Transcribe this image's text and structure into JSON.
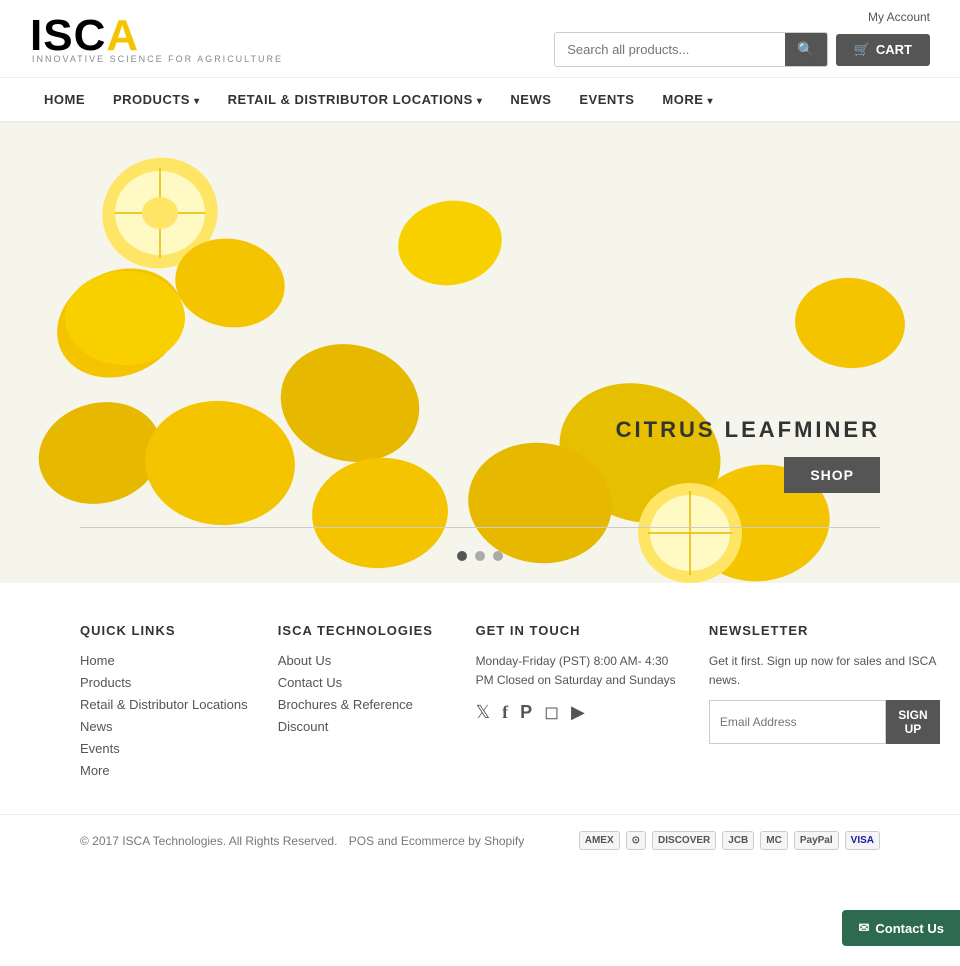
{
  "header": {
    "my_account_label": "My Account",
    "search_placeholder": "Search all products...",
    "search_button_label": "🔍",
    "cart_label": "CART"
  },
  "nav": {
    "items": [
      {
        "label": "HOME",
        "href": "#",
        "has_dropdown": false
      },
      {
        "label": "PRODUCTS",
        "href": "#",
        "has_dropdown": true
      },
      {
        "label": "RETAIL & DISTRIBUTOR LOCATIONS",
        "href": "#",
        "has_dropdown": true
      },
      {
        "label": "NEWS",
        "href": "#",
        "has_dropdown": false
      },
      {
        "label": "EVENTS",
        "href": "#",
        "has_dropdown": false
      },
      {
        "label": "MORE",
        "href": "#",
        "has_dropdown": true
      }
    ]
  },
  "hero": {
    "title": "CITRUS LEAFMINER",
    "shop_button": "SHOP",
    "dots": [
      1,
      2,
      3
    ]
  },
  "footer": {
    "quick_links": {
      "title": "QUICK LINKS",
      "items": [
        {
          "label": "Home",
          "href": "#"
        },
        {
          "label": "Products",
          "href": "#"
        },
        {
          "label": "Retail & Distributor Locations",
          "href": "#"
        },
        {
          "label": "News",
          "href": "#"
        },
        {
          "label": "Events",
          "href": "#"
        },
        {
          "label": "More",
          "href": "#"
        }
      ]
    },
    "isca_tech": {
      "title": "ISCA TECHNOLOGIES",
      "items": [
        {
          "label": "About Us",
          "href": "#"
        },
        {
          "label": "Contact Us",
          "href": "#"
        },
        {
          "label": "Brochures & Reference",
          "href": "#"
        },
        {
          "label": "Discount",
          "href": "#"
        }
      ]
    },
    "get_in_touch": {
      "title": "GET IN TOUCH",
      "hours": "Monday-Friday (PST) 8:00 AM- 4:30 PM Closed on Saturday and Sundays",
      "social": [
        {
          "name": "twitter",
          "icon": "𝕏"
        },
        {
          "name": "facebook",
          "icon": "f"
        },
        {
          "name": "pinterest",
          "icon": "P"
        },
        {
          "name": "instagram",
          "icon": "◻"
        },
        {
          "name": "youtube",
          "icon": "▶"
        }
      ]
    },
    "newsletter": {
      "title": "NEWSLETTER",
      "description": "Get it first. Sign up now for sales and ISCA news.",
      "email_placeholder": "Email Address",
      "button_label": "SIGN UP"
    },
    "bottom": {
      "copyright": "© 2017 ISCA Technologies. All Rights Reserved.",
      "pos_text": "POS and",
      "ecommerce_text": "Ecommerce by Shopify",
      "payment_icons": [
        "AMEX",
        "DINERS",
        "DISCOVER",
        "JCB",
        "MASTER",
        "PAYPAL",
        "VISA"
      ]
    }
  },
  "contact_float": {
    "label": "Contact Us",
    "icon": "✉"
  }
}
